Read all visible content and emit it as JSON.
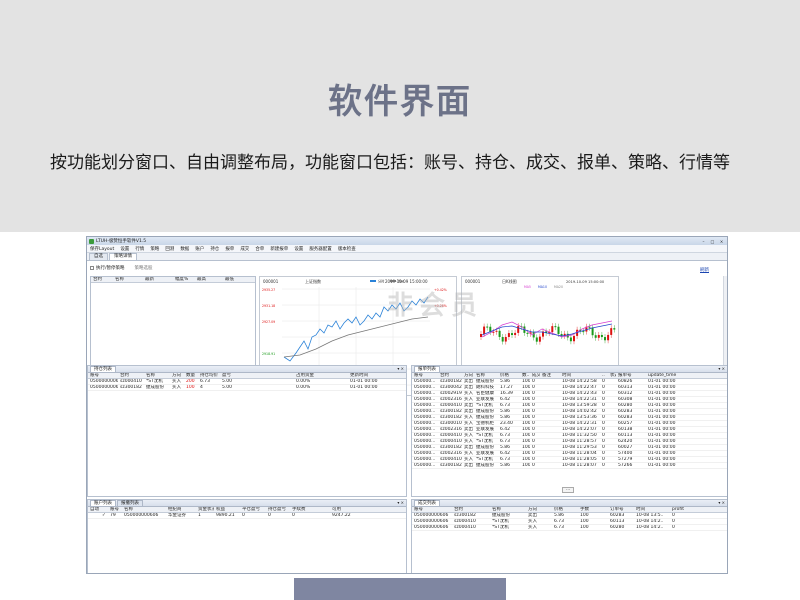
{
  "slide": {
    "title": "软件界面",
    "subtitle": "按功能划分窗口、自由调整布局，功能窗口包括：账号、持仓、成交、报单、策略、行情等"
  },
  "app": {
    "window_title": "LTUH-极赞恒手软件V1.5",
    "menu": [
      "保存Layout",
      "设置",
      "行情",
      "策略",
      "回测",
      "数据",
      "账户",
      "持仓",
      "报单",
      "成交",
      "合单",
      "新建报单",
      "设置",
      "服务器配置",
      "版本检查"
    ],
    "tabs": [
      "自选",
      "策略详情"
    ],
    "toolbar": {
      "checkbox_label": "执行/暂停策略",
      "filter_label": "策略选股"
    },
    "right_link": "刷新",
    "watermark": "非会员",
    "strategy_table": {
      "columns": [
        "合约",
        "名称",
        "最新",
        "幅度%",
        "最高",
        "最低"
      ]
    },
    "chart1": {
      "title": "上证指数",
      "code": "000001",
      "date": "2019-10-09 15:00:00",
      "legend": [
        "分时",
        "均价"
      ]
    },
    "chart2": {
      "title": "日K线图",
      "code": "000001",
      "date": "2019-10-09 15:00:00",
      "legend": [
        "MA5",
        "MA10",
        "MA20"
      ]
    },
    "positions": {
      "title": "持仓列表",
      "columns": [
        "账号",
        "合约",
        "名称",
        "方向",
        "数量",
        "持仓均价",
        "盈亏",
        "",
        "占用资金",
        "",
        "更新时间"
      ],
      "rows": [
        [
          "050000000606",
          "sz000410",
          "*ST沈机",
          "买入",
          "200",
          "6.73",
          "5.00",
          "",
          "0.00%",
          "",
          "01-01 00:00"
        ],
        [
          "050000000606",
          "sz300182",
          "捷成股份",
          "买入",
          "100",
          "4",
          "5.00",
          "",
          "0.00%",
          "",
          "01-01 00:00"
        ]
      ]
    },
    "orders": {
      "title": "报单列表",
      "columns": [
        "账号",
        "合约",
        "方向",
        "名称",
        "价格",
        "数..",
        "成交",
        "备注",
        "时间",
        "..",
        "状态",
        "报单号",
        "update_time"
      ],
      "rows": [
        [
          "050000...",
          "sz300182",
          "卖出",
          "捷成股份",
          "5.86",
          "100",
          "0",
          "",
          "10-08 14:22:58",
          "0",
          "",
          "60826",
          "01-01 00:00"
        ],
        [
          "050000...",
          "sz300042",
          "卖出",
          "朗科科技",
          "17.27",
          "100",
          "0",
          "",
          "10-08 14:22:47",
          "0",
          "",
          "60313",
          "01-01 00:00"
        ],
        [
          "050000...",
          "sz002919",
          "买入",
          "名臣健康",
          "16.39",
          "100",
          "0",
          "",
          "10-08 14:22:43",
          "0",
          "",
          "60312",
          "01-01 00:00"
        ],
        [
          "050000...",
          "sz002316",
          "买入",
          "亚联发展",
          "6.42",
          "100",
          "0",
          "",
          "10-08 14:22:31",
          "0",
          "",
          "60308",
          "01-01 00:00"
        ],
        [
          "050000...",
          "sz000410",
          "卖出",
          "*ST沈机",
          "6.73",
          "100",
          "0",
          "",
          "10-08 13:59:28",
          "0",
          "",
          "60280",
          "01-01 00:00"
        ],
        [
          "050000...",
          "sz300182",
          "卖出",
          "捷成股份",
          "5.86",
          "100",
          "0",
          "",
          "10-08 14:02:42",
          "0",
          "",
          "60283",
          "01-01 00:00"
        ],
        [
          "050000...",
          "sz300182",
          "买入",
          "捷成股份",
          "5.86",
          "100",
          "0",
          "",
          "10-08 13:53:36",
          "0",
          "",
          "60283",
          "01-01 00:00"
        ],
        [
          "050000...",
          "sz300010",
          "买入",
          "宝德机柜",
          "23.40",
          "100",
          "0",
          "",
          "10-08 14:22:31",
          "0",
          "",
          "60257",
          "01-01 00:00"
        ],
        [
          "050000...",
          "sz002316",
          "卖出",
          "亚联发展",
          "6.42",
          "100",
          "0",
          "",
          "10-08 14:22:07",
          "0",
          "",
          "60138",
          "01-01 00:00"
        ],
        [
          "050000...",
          "sz000410",
          "买入",
          "*ST沈机",
          "6.73",
          "100",
          "0",
          "",
          "10-08 11:32:50",
          "0",
          "",
          "60113",
          "01-01 00:00"
        ],
        [
          "050000...",
          "sz000410",
          "买入",
          "*ST沈机",
          "6.73",
          "100",
          "0",
          "",
          "10-08 11:28:57",
          "0",
          "",
          "62420",
          "01-01 00:00"
        ],
        [
          "050000...",
          "sz300182",
          "卖出",
          "捷成股份",
          "5.86",
          "100",
          "0",
          "",
          "10-08 11:29:53",
          "0",
          "",
          "60027",
          "01-01 00:00"
        ],
        [
          "050000...",
          "sz002316",
          "买入",
          "亚联发展",
          "6.42",
          "100",
          "0",
          "",
          "10-08 11:28:04",
          "0",
          "",
          "57400",
          "01-01 00:00"
        ],
        [
          "050000...",
          "sz000410",
          "买入",
          "*ST沈机",
          "6.73",
          "100",
          "0",
          "",
          "10-08 11:28:05",
          "0",
          "",
          "57279",
          "01-01 00:00"
        ],
        [
          "050000...",
          "sz300182",
          "卖出",
          "捷成股份",
          "5.86",
          "100",
          "0",
          "",
          "10-08 11:28:07",
          "0",
          "",
          "57266",
          "01-01 00:00"
        ]
      ],
      "pager": "..."
    },
    "accounts": {
      "tabs": [
        "账户列表",
        "报撤列表"
      ],
      "columns": [
        "自动",
        "",
        "账号",
        "名称",
        "经纪商",
        "资金状况",
        "权益",
        "平仓盈亏",
        "持仓盈亏",
        "手续费",
        "",
        "可用"
      ],
      "rows": [
        [
          "",
          "✓",
          "79",
          "050000000606",
          "华金证券",
          "1",
          "9890.21",
          "0",
          "0",
          "0",
          "",
          "9247.22"
        ]
      ]
    },
    "trades": {
      "title": "成交列表",
      "columns": [
        "账号",
        "合约",
        "名称",
        "方向",
        "价格",
        "手数",
        "订单号",
        "时间",
        "profit"
      ],
      "rows": [
        [
          "050000000606",
          "sz300182",
          "捷成股份",
          "卖出",
          "5.86",
          "100",
          "60283",
          "10-08 13:5..",
          "0"
        ],
        [
          "050000000606",
          "sz000410",
          "*ST沈机",
          "买入",
          "6.73",
          "100",
          "60113",
          "10-08 14:2..",
          "0"
        ],
        [
          "050000000606",
          "sz000410",
          "*ST沈机",
          "买入",
          "6.73",
          "100",
          "60280",
          "10-08 14:2..",
          "0"
        ]
      ]
    }
  },
  "colors": {
    "hero_bg": "#e3e3e3",
    "title_color": "#6c7288",
    "accent_bar": "#7f86a1",
    "up": "#d11",
    "down": "#1a9a1a"
  }
}
